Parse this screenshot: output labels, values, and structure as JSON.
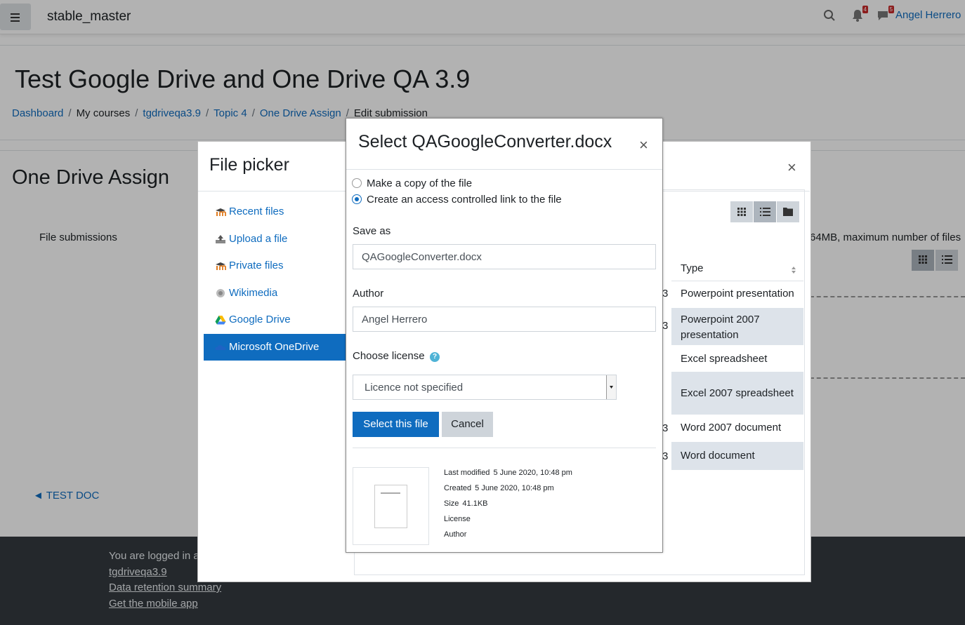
{
  "navbar": {
    "site_name": "stable_master",
    "notifications_count": "4",
    "messages_count": "5",
    "user_name": "Angel Herrero"
  },
  "page": {
    "course_title": "Test Google Drive and One Drive QA 3.9",
    "breadcrumb": [
      "Dashboard",
      "My courses",
      "tgdriveqa3.9",
      "Topic 4",
      "One Drive Assign",
      "Edit submission"
    ],
    "heading": "One Drive Assign",
    "file_submissions_label": "File submissions",
    "limit_info": "64MB, maximum number of files",
    "prev_activity": "◄ TEST DOC"
  },
  "footer": {
    "logged_in": "You are logged in a",
    "course_link": "tgdriveqa3.9",
    "data_retention": "Data retention summary",
    "mobile_app": "Get the mobile app"
  },
  "file_picker": {
    "title": "File picker",
    "close": "×",
    "repositories": [
      {
        "label": "Recent files",
        "icon": "moodle-icon"
      },
      {
        "label": "Upload a file",
        "icon": "upload-icon"
      },
      {
        "label": "Private files",
        "icon": "moodle-icon"
      },
      {
        "label": "Wikimedia",
        "icon": "wikimedia-icon"
      },
      {
        "label": "Google Drive",
        "icon": "google-drive-icon"
      },
      {
        "label": "Microsoft OneDrive",
        "icon": "onedrive-icon"
      }
    ],
    "type_header": "Type",
    "file_types": [
      "Powerpoint presentation",
      "Powerpoint 2007 presentation",
      "Excel spreadsheet",
      "Excel 2007 spreadsheet",
      "Word 2007 document",
      "Word document"
    ],
    "size_fragment": "3"
  },
  "dialog": {
    "title": "Select QAGoogleConverter.docx",
    "close": "×",
    "option_copy": "Make a copy of the file",
    "option_link": "Create an access controlled link to the file",
    "save_as_label": "Save as",
    "save_as_value": "QAGoogleConverter.docx",
    "author_label": "Author",
    "author_value": "Angel Herrero",
    "license_label": "Choose license",
    "license_value": "Licence not specified",
    "select_button": "Select this file",
    "cancel_button": "Cancel",
    "meta": {
      "last_modified_label": "Last modified",
      "last_modified_value": "5 June 2020, 10:48 pm",
      "created_label": "Created",
      "created_value": "5 June 2020, 10:48 pm",
      "size_label": "Size",
      "size_value": "41.1KB",
      "license_label": "License",
      "author_label": "Author"
    }
  },
  "colors": {
    "accent": "#0f6cbf",
    "footer_bg": "#343a40",
    "row_alt": "#dde3ea"
  }
}
